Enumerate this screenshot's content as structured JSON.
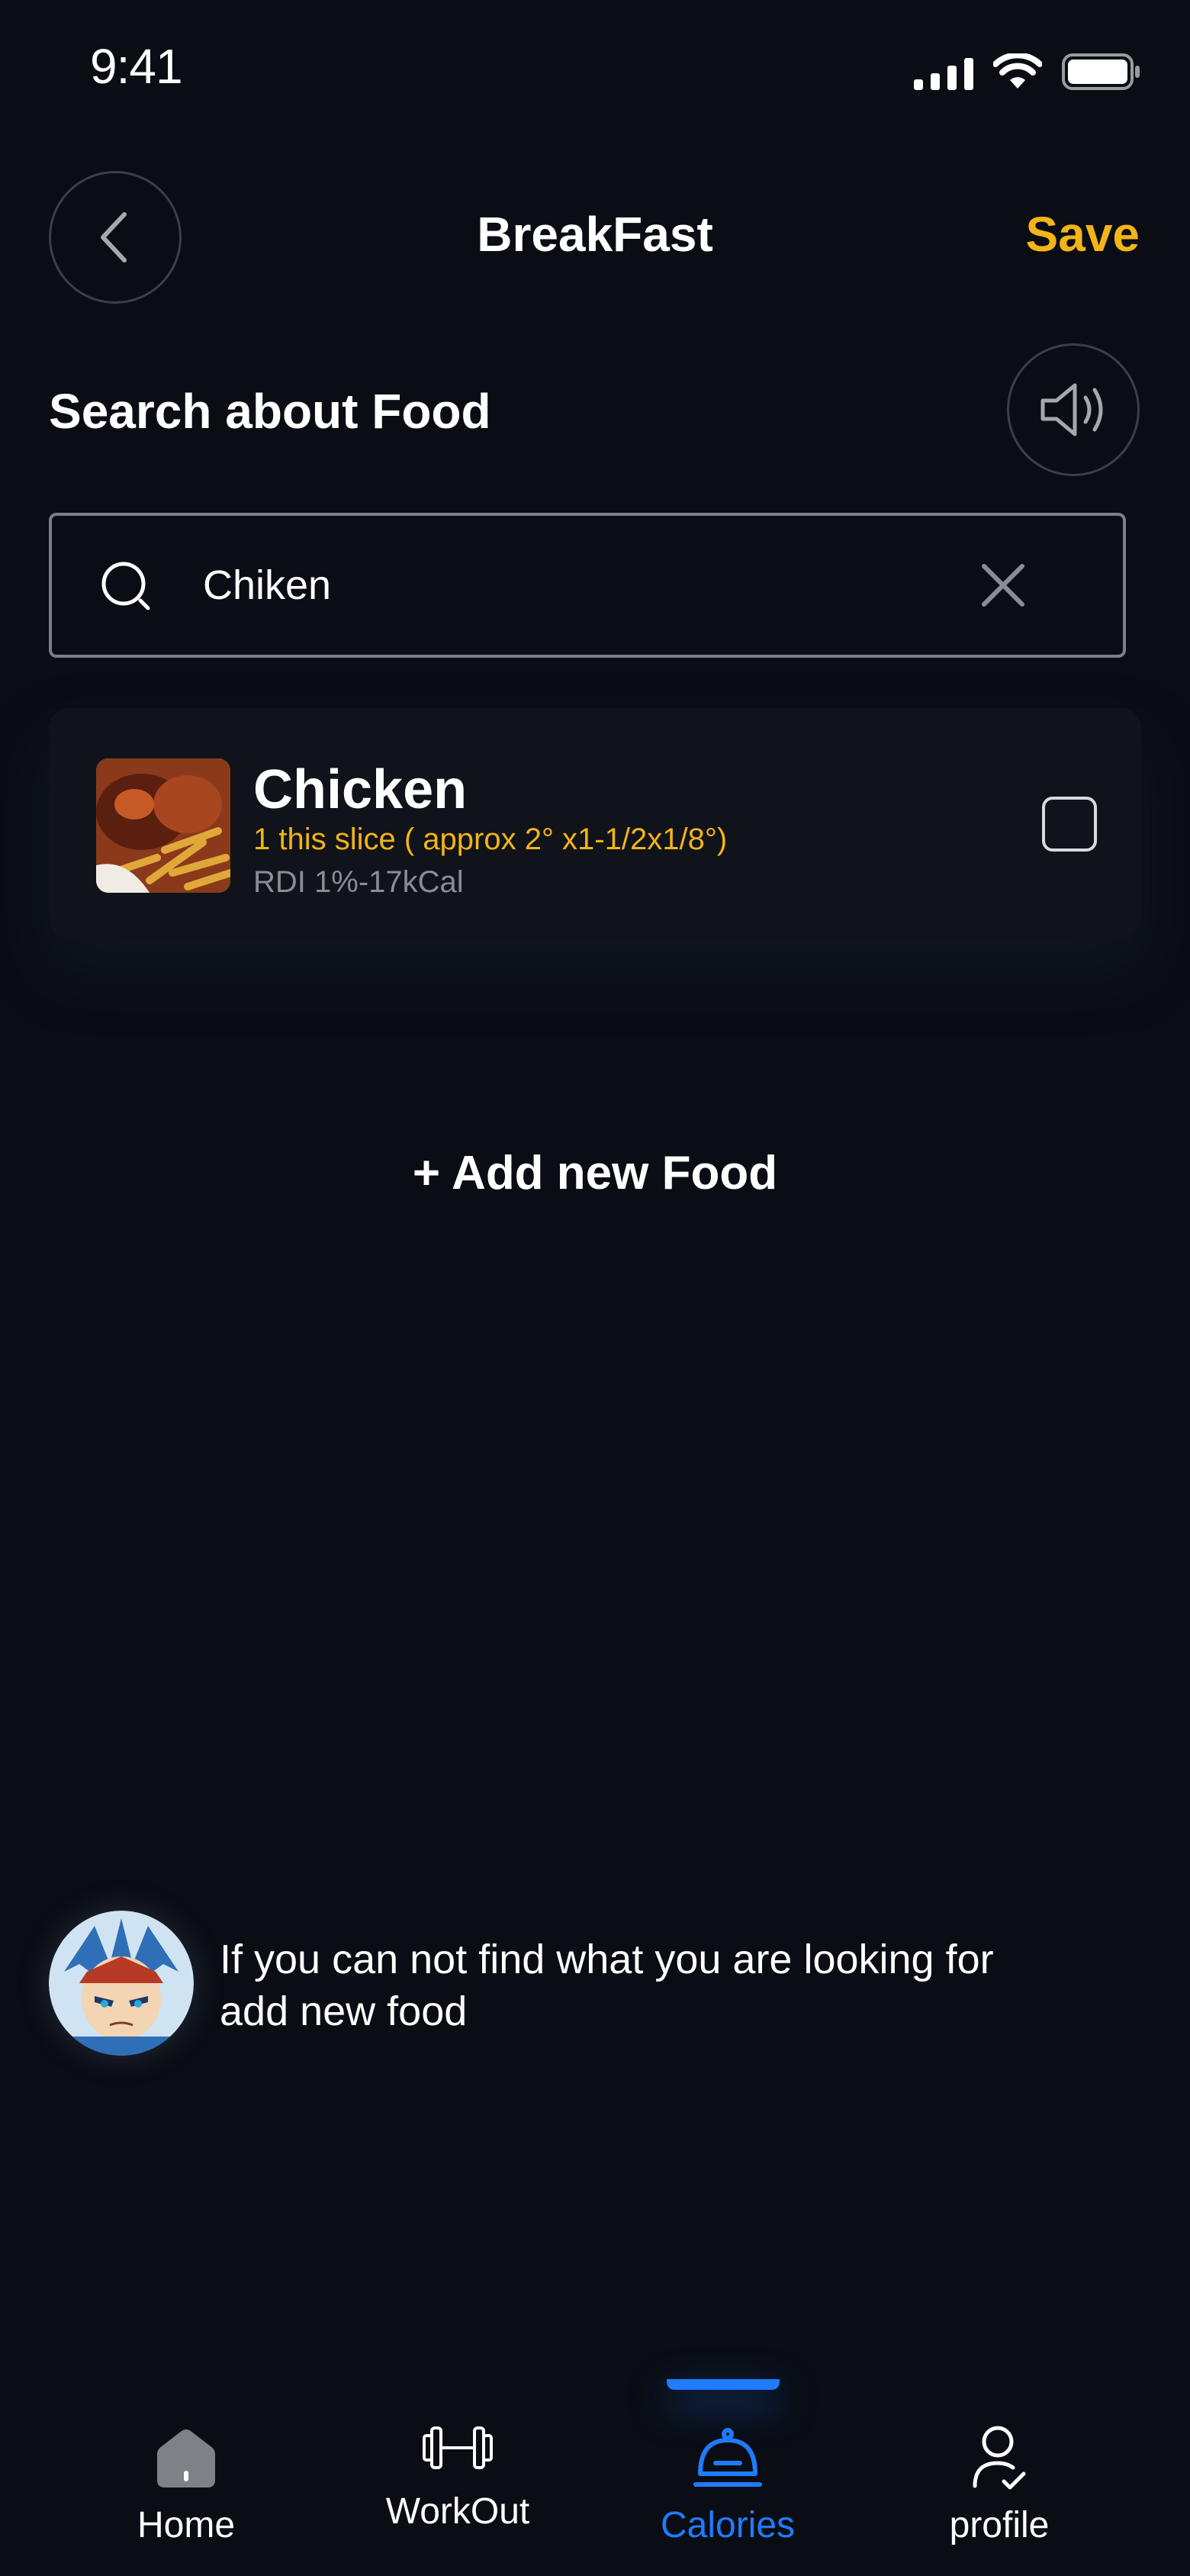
{
  "status_bar": {
    "time": "9:41"
  },
  "header": {
    "title": "BreakFast",
    "save_label": "Save"
  },
  "section": {
    "title": "Search about Food"
  },
  "search": {
    "value": "Chiken",
    "placeholder": "Search"
  },
  "results": [
    {
      "name": "Chicken",
      "portion": "1 this slice ( approx 2° x1-1/2x1/8°)",
      "rdi": "RDI 1%-17kCal",
      "checked": false
    }
  ],
  "add_food": {
    "label": "+ Add new Food"
  },
  "hint": {
    "text": "If you can not find what you are looking for add new food"
  },
  "tabs": [
    {
      "label": "Home",
      "icon": "home-icon",
      "active": false
    },
    {
      "label": "WorkOut",
      "icon": "dumbbell-icon",
      "active": false
    },
    {
      "label": "Calories",
      "icon": "cloche-icon",
      "active": true
    },
    {
      "label": "profile",
      "icon": "user-check-icon",
      "active": false
    }
  ],
  "colors": {
    "background": "#0a0d14",
    "accent_yellow": "#f2b417",
    "accent_blue": "#1f7bff",
    "card": "#101319",
    "muted_text": "#8a8d94"
  }
}
